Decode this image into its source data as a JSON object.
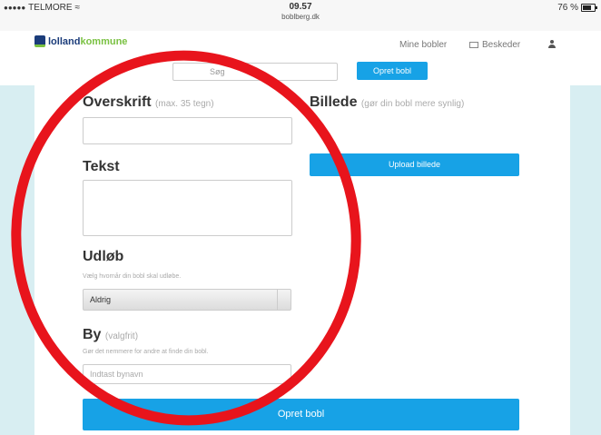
{
  "status_bar": {
    "carrier": "TELMORE",
    "time": "09.57",
    "url": "boblberg.dk",
    "battery": "76 %"
  },
  "navbar": {
    "logo_part1": "lolland",
    "logo_part2": "kommune",
    "mine_bobler": "Mine bobler",
    "beskeder": "Beskeder"
  },
  "search": {
    "placeholder": "Søg",
    "opret_label": "Opret bobl"
  },
  "form": {
    "overskrift": {
      "label": "Overskrift",
      "hint": "(max. 35 tegn)",
      "value": ""
    },
    "tekst": {
      "label": "Tekst",
      "value": ""
    },
    "udlob": {
      "label": "Udløb",
      "help": "Vælg hvornår din bobl skal udløbe.",
      "selected": "Aldrig"
    },
    "by": {
      "label": "By",
      "hint": "(valgfrit)",
      "help": "Gør det nemmere for andre at finde din bobl.",
      "placeholder": "Indtast bynavn"
    },
    "billede": {
      "label": "Billede",
      "hint": "(gør din bobl mere synlig)",
      "upload_label": "Upload billede"
    },
    "submit_label": "Opret bobl"
  },
  "colors": {
    "accent": "#17a2e6",
    "annotation": "#e8141c",
    "side_background": "#d8eef2"
  }
}
